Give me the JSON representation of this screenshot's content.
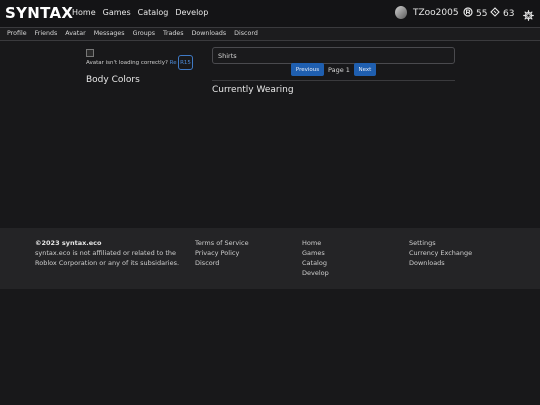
{
  "header": {
    "logo": "SYNTAX",
    "nav": [
      "Home",
      "Games",
      "Catalog",
      "Develop"
    ],
    "username": "TZoo2005",
    "currency_primary": "55",
    "currency_secondary": "63"
  },
  "subnav": [
    "Profile",
    "Friends",
    "Avatar",
    "Messages",
    "Groups",
    "Trades",
    "Downloads",
    "Discord"
  ],
  "left": {
    "avatar_hint": "Avatar isn't loading correctly?",
    "avatar_hint_link": "Re",
    "r15_label": "R15",
    "body_colors": "Body Colors"
  },
  "right": {
    "category": "Shirts",
    "prev": "Previous",
    "page": "Page 1",
    "next": "Next",
    "currently_wearing": "Currently Wearing"
  },
  "footer": {
    "copyright": "©2023 syntax.eco",
    "disclaimer": "syntax.eco is not affiliated or related to the Roblox Corporation or any of its subsidaries.",
    "col1": [
      "Terms of Service",
      "Privacy Policy",
      "Discord"
    ],
    "col2": [
      "Home",
      "Games",
      "Catalog",
      "Develop"
    ],
    "col3": [
      "Settings",
      "Currency Exchange",
      "Downloads"
    ]
  },
  "colors": {
    "background": "#18181a",
    "accent": "#1f5fb0",
    "footer": "#242426"
  },
  "icons": {
    "currency_primary": "robux-icon",
    "currency_secondary": "tix-icon",
    "settings": "gear-icon"
  }
}
